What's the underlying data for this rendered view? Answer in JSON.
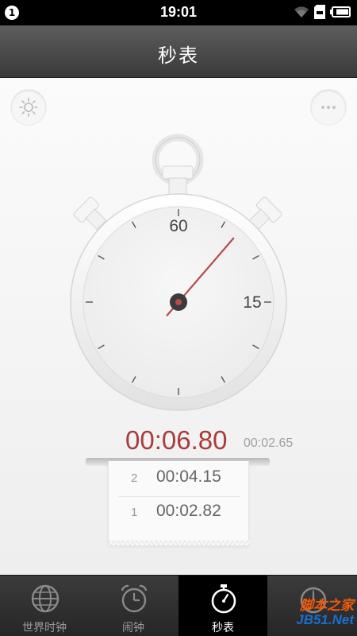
{
  "status_bar": {
    "notification_count": "1",
    "time": "19:01",
    "icons": [
      "wifi-icon",
      "sd-card-icon",
      "battery-icon"
    ]
  },
  "header": {
    "title": "秒表"
  },
  "toolbar": {
    "settings_icon": "sun-gear-icon",
    "more_icon": "more-dots-icon"
  },
  "stopwatch": {
    "dial_labels": [
      "60",
      "15"
    ],
    "hand_seconds": 6.8,
    "elapsed": "00:06.80",
    "current_lap": "00:02.65",
    "hand_color": "#b84a4a"
  },
  "laps": [
    {
      "number": "2",
      "time": "00:04.15"
    },
    {
      "number": "1",
      "time": "00:02.82"
    }
  ],
  "tabs": [
    {
      "label": "世界时钟",
      "icon": "globe-icon",
      "active": false
    },
    {
      "label": "闹钟",
      "icon": "alarm-clock-icon",
      "active": false
    },
    {
      "label": "秒表",
      "icon": "stopwatch-icon",
      "active": true
    },
    {
      "label": "",
      "icon": "timer-gauge-icon",
      "active": false
    }
  ],
  "watermark": {
    "line1": "脚本之家",
    "line2": "JB51.Net"
  }
}
